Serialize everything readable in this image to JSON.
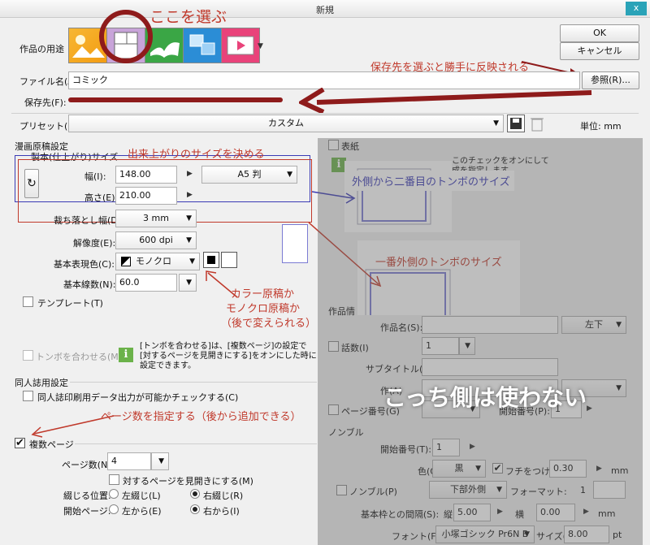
{
  "window": {
    "title": "新規",
    "close": "x"
  },
  "usage": {
    "label": "作品の用途"
  },
  "buttons": {
    "ok": "OK",
    "cancel": "キャンセル",
    "browse": "参照(R)..."
  },
  "filename": {
    "label": "ファイル名(A):",
    "value": "コミック"
  },
  "save": {
    "label": "保存先(F):"
  },
  "preset": {
    "label": "プリセット(S):",
    "value": "カスタム",
    "unit_label": "単位:",
    "unit": "mm"
  },
  "manga": {
    "section": "漫画原稿設定",
    "finish_size": "製本(仕上がり)サイズ",
    "width_label": "幅(I):",
    "width": "148.00",
    "size_preset": "A5 判",
    "height_label": "高さ(E):",
    "height": "210.00",
    "bleed_label": "裁ち落とし幅(D):",
    "bleed": "3 mm",
    "dpi_label": "解像度(E):",
    "dpi": "600 dpi",
    "color_label": "基本表現色(C):",
    "color": "モノクロ",
    "lpi_label": "基本線数(N):",
    "lpi": "60.0",
    "template": "テンプレート(T)",
    "tombo": "トンボを合わせる(M)",
    "tombo_info": [
      "[トンボを合わせる]は、[複数ページ]の設定で",
      "[対するページを見開きにする]をオンにした時に",
      "設定できます。"
    ]
  },
  "doujin": {
    "section": "同人誌用設定",
    "print": "同人誌印刷用データ出力が可能かチェックする(C)"
  },
  "multi": {
    "label": "複数ページ",
    "pages_label": "ページ数(N):",
    "pages": "4",
    "spread": "対するページを見開きにする(M)",
    "bind_label": "綴じる位置:",
    "bind_left": "左綴じ(L)",
    "bind_right": "右綴じ(R)",
    "start_label": "開始ページ:",
    "start_left": "左から(E)",
    "start_right": "右から(I)"
  },
  "cover": {
    "label": "表紙",
    "info": [
      "このチェックをオンにして",
      "成を指定します。"
    ]
  },
  "work": {
    "section": "作品情",
    "name_label": "作品名(S):",
    "pos": "左下",
    "episode_label": "話数(I)",
    "episode": "1",
    "subtitle_label": "サブタイトル(U):",
    "author_prefix": "作",
    "author_suffix": "(A)",
    "page_label": "ページ番号(G)",
    "page_start_label": "開始番号(P):",
    "page_start": "1"
  },
  "nombre": {
    "section": "ノンブル",
    "start_label": "開始番号(T):",
    "start": "1",
    "color_label": "色(O):",
    "color": "黒",
    "edge_label": "フチをつける(E)",
    "edge": "0.30",
    "mm1": "mm",
    "nombre_label": "ノンブル(P)",
    "pos": "下部外側",
    "format_label": "フォーマット:",
    "format": "1",
    "gap_label": "基本枠との間隔(S):",
    "gap_v_label": "縦",
    "gap_v": "5.00",
    "gap_h_label": "横",
    "gap_h": "0.00",
    "mm2": "mm",
    "font_label": "フォント(F):",
    "font": "小塚ゴシック Pr6N B",
    "size_label": "サイズ(Z):",
    "size": "8.00",
    "pt": "pt"
  },
  "annotations": {
    "choose": "ここを選ぶ",
    "save_hint": "保存先を選ぶと勝手に反映される",
    "finish": "出来上がりのサイズを決める",
    "inner": "外側から二番目のトンボのサイズ",
    "outer": "一番外側のトンボのサイズ",
    "color_note": [
      "カラー原稿か",
      "モノクロ原稿か",
      "（後で変えられる）"
    ],
    "pages_note": "ページ数を指定する（後から追加できる）",
    "unused": "こっち側は使わない"
  }
}
